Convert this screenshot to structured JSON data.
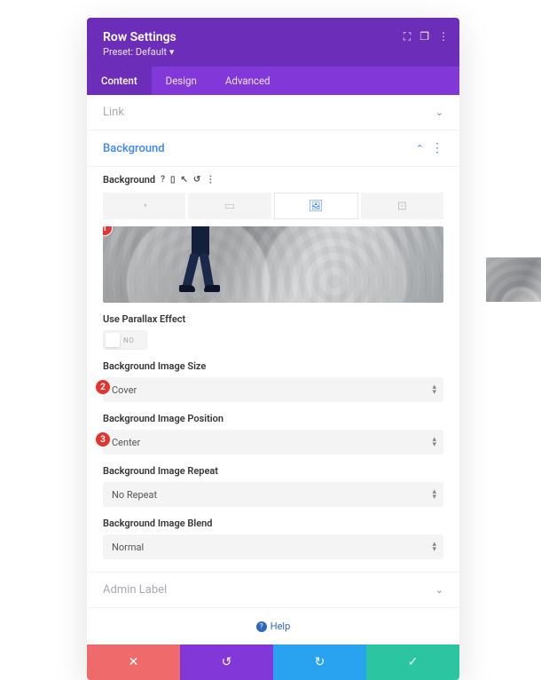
{
  "header": {
    "title": "Row Settings",
    "preset_label": "Preset: Default ▾"
  },
  "tabs": [
    "Content",
    "Design",
    "Advanced"
  ],
  "active_tab": 0,
  "sections": {
    "link": {
      "title": "Link"
    },
    "background": {
      "title": "Background"
    },
    "admin_label": {
      "title": "Admin Label"
    }
  },
  "background_panel": {
    "label": "Background",
    "type_tabs": [
      "color-swatch-icon",
      "gradient-icon",
      "image-icon",
      "video-icon"
    ],
    "active_type": 2
  },
  "fields": {
    "parallax": {
      "label": "Use Parallax Effect",
      "value_text": "NO"
    },
    "size": {
      "label": "Background Image Size",
      "value": "Cover"
    },
    "position": {
      "label": "Background Image Position",
      "value": "Center"
    },
    "repeat": {
      "label": "Background Image Repeat",
      "value": "No Repeat"
    },
    "blend": {
      "label": "Background Image Blend",
      "value": "Normal"
    }
  },
  "annotations": {
    "preview": "1",
    "size": "2",
    "position": "3"
  },
  "help": {
    "label": "Help"
  },
  "footer_icons": {
    "cancel": "✕",
    "undo": "↺",
    "redo": "↻",
    "save": "✓"
  }
}
